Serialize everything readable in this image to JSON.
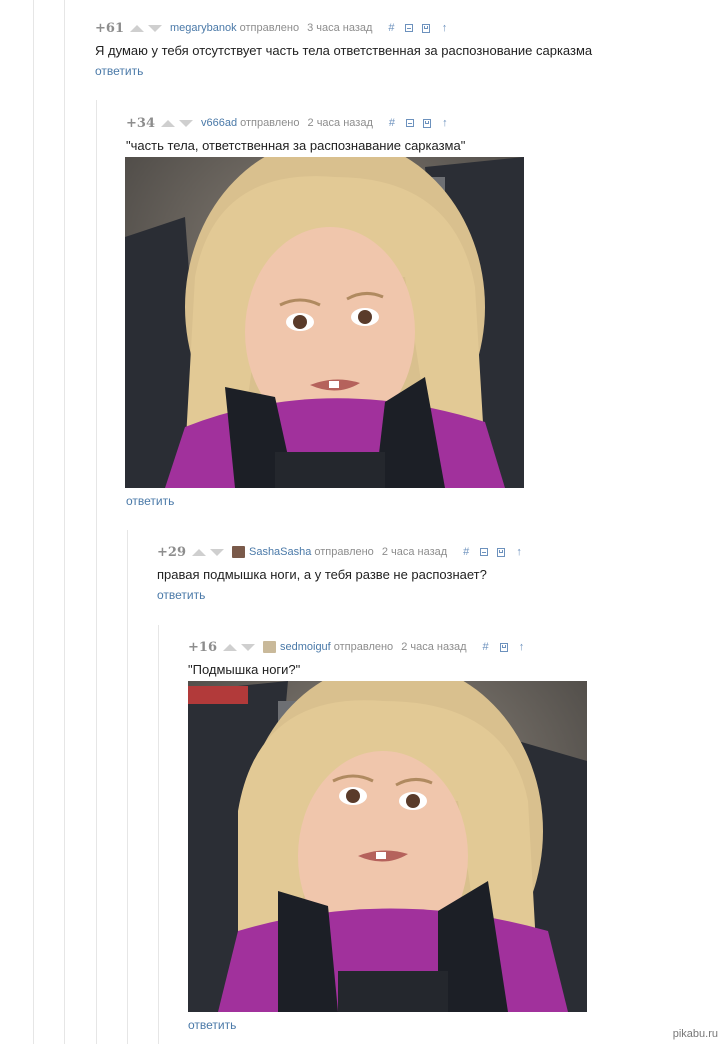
{
  "comments": [
    {
      "score": "+61",
      "author": "megarybanok",
      "sent": "отправлено",
      "time": "3 часа назад",
      "text": "Я думаю у тебя отсутствует часть тела ответственная за распознование сарказма",
      "reply": "ответить"
    },
    {
      "score": "+34",
      "author": "v666ad",
      "sent": "отправлено",
      "time": "2 часа назад",
      "text": "\"часть тела, ответственная за распознавание сарказма\"",
      "reply": "ответить"
    },
    {
      "score": "+29",
      "author": "SashaSasha",
      "sent": "отправлено",
      "time": "2 часа назад",
      "text": "правая подмышка ноги, а у тебя разве не распознает?",
      "reply": "ответить"
    },
    {
      "score": "+16",
      "author": "sedmoiguf",
      "sent": "отправлено",
      "time": "2 часа назад",
      "text": "\"Подмышка ноги?\"",
      "reply": "ответить"
    }
  ],
  "actions": {
    "hash": "#",
    "up": "↑"
  },
  "watermark": "pikabu.ru"
}
